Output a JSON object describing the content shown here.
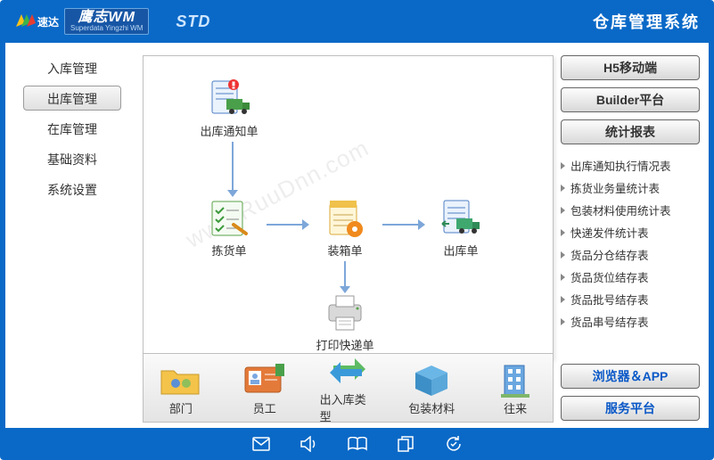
{
  "header": {
    "brand_suda": "速达",
    "brand_wm": "鹰志WM",
    "brand_sub": "Superdata Yingzhi WM",
    "std": "STD",
    "title": "仓库管理系统"
  },
  "sidebar": {
    "items": [
      {
        "label": "入库管理"
      },
      {
        "label": "出库管理"
      },
      {
        "label": "在库管理"
      },
      {
        "label": "基础资料"
      },
      {
        "label": "系统设置"
      }
    ],
    "active_index": 1
  },
  "flow": {
    "notice": "出库通知单",
    "pick": "拣货单",
    "pack": "装箱单",
    "out": "出库单",
    "print": "打印快递单"
  },
  "bottom": {
    "items": [
      {
        "label": "部门"
      },
      {
        "label": "员工"
      },
      {
        "label": "出入库类型"
      },
      {
        "label": "包装材料"
      },
      {
        "label": "往来"
      }
    ]
  },
  "right": {
    "buttons": [
      {
        "label": "H5移动端"
      },
      {
        "label": "Builder平台"
      },
      {
        "label": "统计报表"
      }
    ],
    "reports": [
      {
        "label": "出库通知执行情况表"
      },
      {
        "label": "拣货业务量统计表"
      },
      {
        "label": "包装材料使用统计表"
      },
      {
        "label": "快递发件统计表"
      },
      {
        "label": "货品分仓结存表"
      },
      {
        "label": "货品货位结存表"
      },
      {
        "label": "货品批号结存表"
      },
      {
        "label": "货品串号结存表"
      }
    ],
    "footer_buttons": [
      {
        "label": "浏览器＆APP"
      },
      {
        "label": "服务平台"
      }
    ]
  },
  "watermark": "www.RuuDnn.com"
}
